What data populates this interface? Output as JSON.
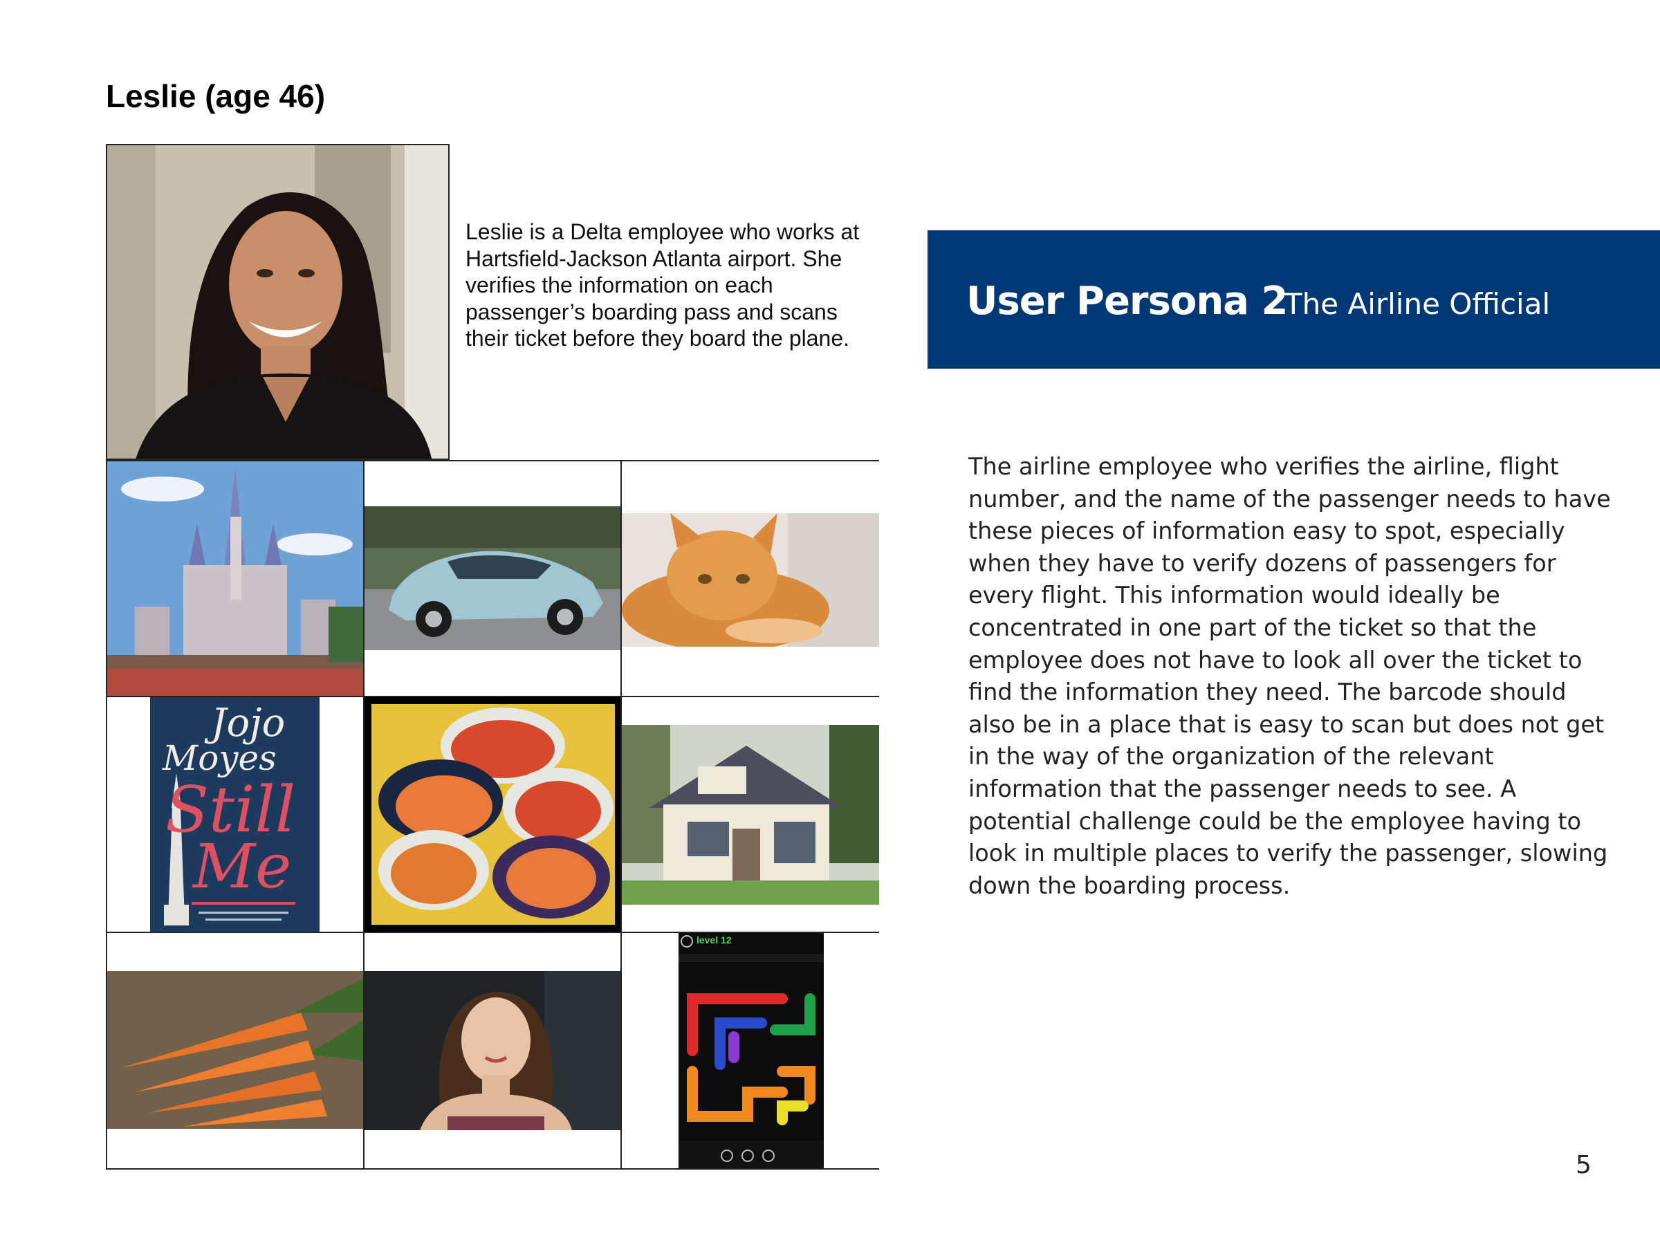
{
  "persona": {
    "name_heading": "Leslie (age 46)",
    "intro": "Leslie is a Delta employee who works at Hartsfield-Jackson Atlanta airport. She verifies the information on each passenger’s boarding pass and scans their ticket before they board the plane."
  },
  "banner": {
    "title": "User Persona 2",
    "subtitle": "The Airline Official",
    "color": "#003976"
  },
  "description": "The airline employee who verifies the airline, flight number, and the name of the passenger needs to have these pieces of information easy to spot, especially when they have to verify dozens of passengers for every flight. This information would ideally be concentrated in one part of the ticket so that the employee does not have to look all over the ticket to find the information they need. The barcode should also be in a place that is easy to scan but does not get in the way of the organization of the relevant information that the passenger needs to see. A potential challenge could be the employee having to look in multiple places to verify the passenger, slowing down the boarding process.",
  "page_number": "5",
  "book_cover": {
    "author_line1": "Jojo",
    "author_line2": "Moyes",
    "title_line1": "Still",
    "title_line2": "Me"
  },
  "game": {
    "level_label": "level 12"
  },
  "moodboard": [
    "castle-photo",
    "car-photo",
    "cat-photo",
    "book-cover-photo",
    "pasta-meals-photo",
    "house-photo",
    "carrots-photo",
    "actress-photo",
    "flow-game-photo"
  ]
}
